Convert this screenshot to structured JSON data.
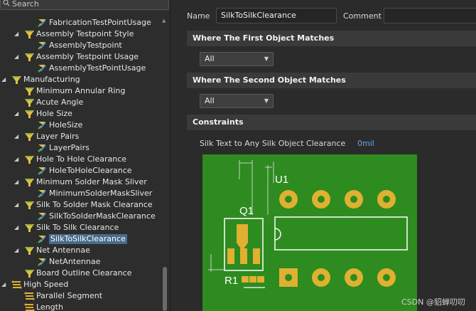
{
  "search": {
    "placeholder": "Search"
  },
  "tree": [
    {
      "label": "FabricationTestPointUsage",
      "level": 2,
      "icon": "rule-icon",
      "arrow": false
    },
    {
      "label": "Assembly Testpoint Style",
      "level": 1,
      "icon": "rule-category-icon",
      "arrow": true
    },
    {
      "label": "AssemblyTestpoint",
      "level": 2,
      "icon": "rule-icon",
      "arrow": false
    },
    {
      "label": "Assembly Testpoint Usage",
      "level": 1,
      "icon": "rule-category-icon",
      "arrow": true
    },
    {
      "label": "AssemblyTestPointUsage",
      "level": 2,
      "icon": "rule-icon",
      "arrow": false
    },
    {
      "label": "Manufacturing",
      "level": 0,
      "icon": "manufacturing-icon",
      "arrow": true
    },
    {
      "label": "Minimum Annular Ring",
      "level": 1,
      "icon": "rule-category-icon",
      "arrow": false
    },
    {
      "label": "Acute Angle",
      "level": 1,
      "icon": "rule-category-icon",
      "arrow": false
    },
    {
      "label": "Hole Size",
      "level": 1,
      "icon": "rule-category-icon",
      "arrow": true
    },
    {
      "label": "HoleSize",
      "level": 2,
      "icon": "rule-icon",
      "arrow": false
    },
    {
      "label": "Layer Pairs",
      "level": 1,
      "icon": "rule-category-icon",
      "arrow": true
    },
    {
      "label": "LayerPairs",
      "level": 2,
      "icon": "rule-icon",
      "arrow": false
    },
    {
      "label": "Hole To Hole Clearance",
      "level": 1,
      "icon": "rule-category-icon",
      "arrow": true
    },
    {
      "label": "HoleToHoleClearance",
      "level": 2,
      "icon": "rule-icon",
      "arrow": false
    },
    {
      "label": "Minimum Solder Mask Sliver",
      "level": 1,
      "icon": "rule-category-icon",
      "arrow": true
    },
    {
      "label": "MinimumSolderMaskSliver",
      "level": 2,
      "icon": "rule-icon",
      "arrow": false
    },
    {
      "label": "Silk To Solder Mask Clearance",
      "level": 1,
      "icon": "rule-category-icon",
      "arrow": true
    },
    {
      "label": "SilkToSolderMaskClearance",
      "level": 2,
      "icon": "rule-icon",
      "arrow": false
    },
    {
      "label": "Silk To Silk Clearance",
      "level": 1,
      "icon": "rule-category-icon",
      "arrow": true
    },
    {
      "label": "SilkToSilkClearance",
      "level": 2,
      "icon": "rule-icon",
      "arrow": false,
      "selected": true
    },
    {
      "label": "Net Antennae",
      "level": 1,
      "icon": "rule-category-icon",
      "arrow": true
    },
    {
      "label": "NetAntennae",
      "level": 2,
      "icon": "rule-icon",
      "arrow": false
    },
    {
      "label": "Board Outline Clearance",
      "level": 1,
      "icon": "rule-category-icon",
      "arrow": false
    },
    {
      "label": "High Speed",
      "level": 0,
      "icon": "high-speed-icon",
      "arrow": true
    },
    {
      "label": "Parallel Segment",
      "level": 1,
      "icon": "high-speed-rule-icon",
      "arrow": false
    },
    {
      "label": "Length",
      "level": 1,
      "icon": "high-speed-rule-icon",
      "arrow": false
    }
  ],
  "form": {
    "name_label": "Name",
    "name_value": "SilkToSilkClearance",
    "comment_label": "Comment",
    "comment_value": ""
  },
  "sections": {
    "first": "Where The First Object Matches",
    "second": "Where The Second Object Matches",
    "constraints": "Constraints"
  },
  "first_match": {
    "selected": "All"
  },
  "second_match": {
    "selected": "All"
  },
  "constraint": {
    "label": "Silk Text to Any Silk Object Clearance",
    "value": "0mil"
  },
  "diagram": {
    "labels": {
      "u1": "U1",
      "q1": "Q1",
      "r1": "R1"
    },
    "colors": {
      "board": "#2e8b1f",
      "pad": "#e0b030",
      "silk": "#ffffff",
      "dim": "#cccccc"
    }
  },
  "watermark": "CSDN @貂蝉叨叨"
}
